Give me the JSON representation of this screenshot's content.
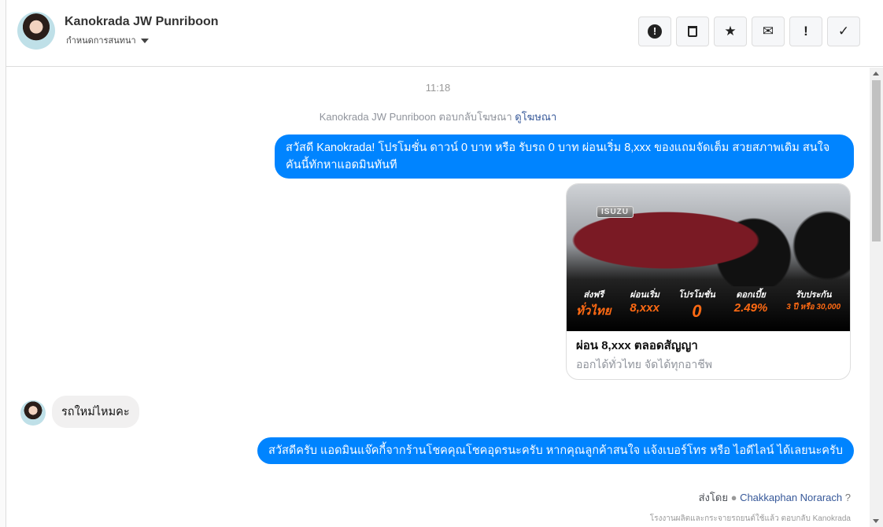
{
  "header": {
    "name": "Kanokrada JW Punriboon",
    "assign_label": "กำหนดการสนทนา",
    "actions": [
      {
        "icon": "alert-circle-icon",
        "glyph": "⬤"
      },
      {
        "icon": "trash-icon",
        "glyph": "🗑"
      },
      {
        "icon": "star-icon",
        "glyph": "★"
      },
      {
        "icon": "envelope-icon",
        "glyph": "✉"
      },
      {
        "icon": "exclamation-icon",
        "glyph": "!"
      },
      {
        "icon": "check-icon",
        "glyph": "✓"
      }
    ]
  },
  "chat": {
    "time": "11:18",
    "replied_text": "Kanokrada JW Punriboon ตอบกลับโฆษณา",
    "view_ad": "ดูโฆษณา",
    "msg1": "สวัสดี Kanokrada! โปรโมชั่น ดาวน์ 0 บาท หรือ รับรถ 0 บาท ผ่อนเริ่ม 8,xxx ของแถมจัดเต็ม สวยสภาพเดิม สนใจคันนี้ทักหาแอดมินทันที",
    "card": {
      "brand": "ISUZU",
      "promos": [
        {
          "t": "ส่งฟรี",
          "v": "ทั่วไทย"
        },
        {
          "t": "ผ่อนเริ่ม",
          "v": "8,xxx"
        },
        {
          "t": "โปรโมชั่น",
          "v": "0"
        },
        {
          "t": "ดอกเบี้ย",
          "v": "2.49%"
        },
        {
          "t": "รับประกัน",
          "v": "3 ปี หรือ 30,000"
        }
      ],
      "title": "ผ่อน 8,xxx ตลอดสัญญา",
      "subtitle": "ออกได้ทั่วไทย จัดได้ทุกอาชีพ"
    },
    "incoming": "รถใหม่ไหมคะ",
    "msg2": "สวัสดีครับ แอดมินแจ๊คกี้จากร้านโชคคุณโชคอุดรนะครับ หากคุณลูกค้าสนใจ แจ้งเบอร์โทร หรือ ไอดีไลน์ ได้เลยนะครับ",
    "sent_by_label": "ส่งโดย",
    "sent_by_name": "Chakkaphan Norarach",
    "note": "โรงงานผลิตและกระจายรถยนต์ใช้แล้ว ตอบกลับ Kanokrada"
  }
}
